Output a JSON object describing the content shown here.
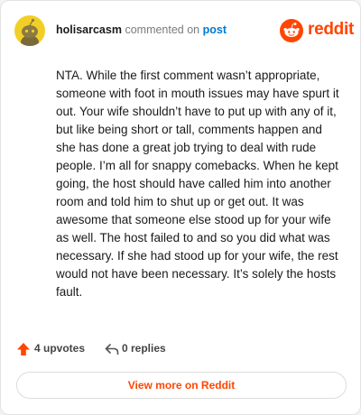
{
  "header": {
    "username": "holisarcasm",
    "commented_on": "commented on",
    "post_link": "post",
    "brand": "reddit"
  },
  "comment": {
    "text": "NTA. While the first comment wasn’t appropriate, someone with foot in mouth issues may have spurt it out. Your wife shouldn’t have to put up with any of it, but like being short or tall, comments happen and she has done a great job trying to deal with rude people. I’m all for snappy comebacks. When he kept going, the host should have called him into another room and told him to shut up or get out. It was awesome that someone else stood up for your wife as well. The host failed to and so you did what was necessary. If she had stood up for your wife, the rest would not have been necessary. It’s solely the hosts fault."
  },
  "footer": {
    "upvotes": "4 upvotes",
    "replies": "0 replies",
    "view_more": "View more on Reddit"
  },
  "icons": {
    "avatar": "snoo-avatar-icon",
    "brand": "reddit-logo-icon",
    "upvote": "upvote-arrow-icon",
    "reply": "reply-arrow-icon"
  },
  "colors": {
    "accent": "#ff4500",
    "link": "#0079d3",
    "avatar_bg": "#f2cf27"
  }
}
